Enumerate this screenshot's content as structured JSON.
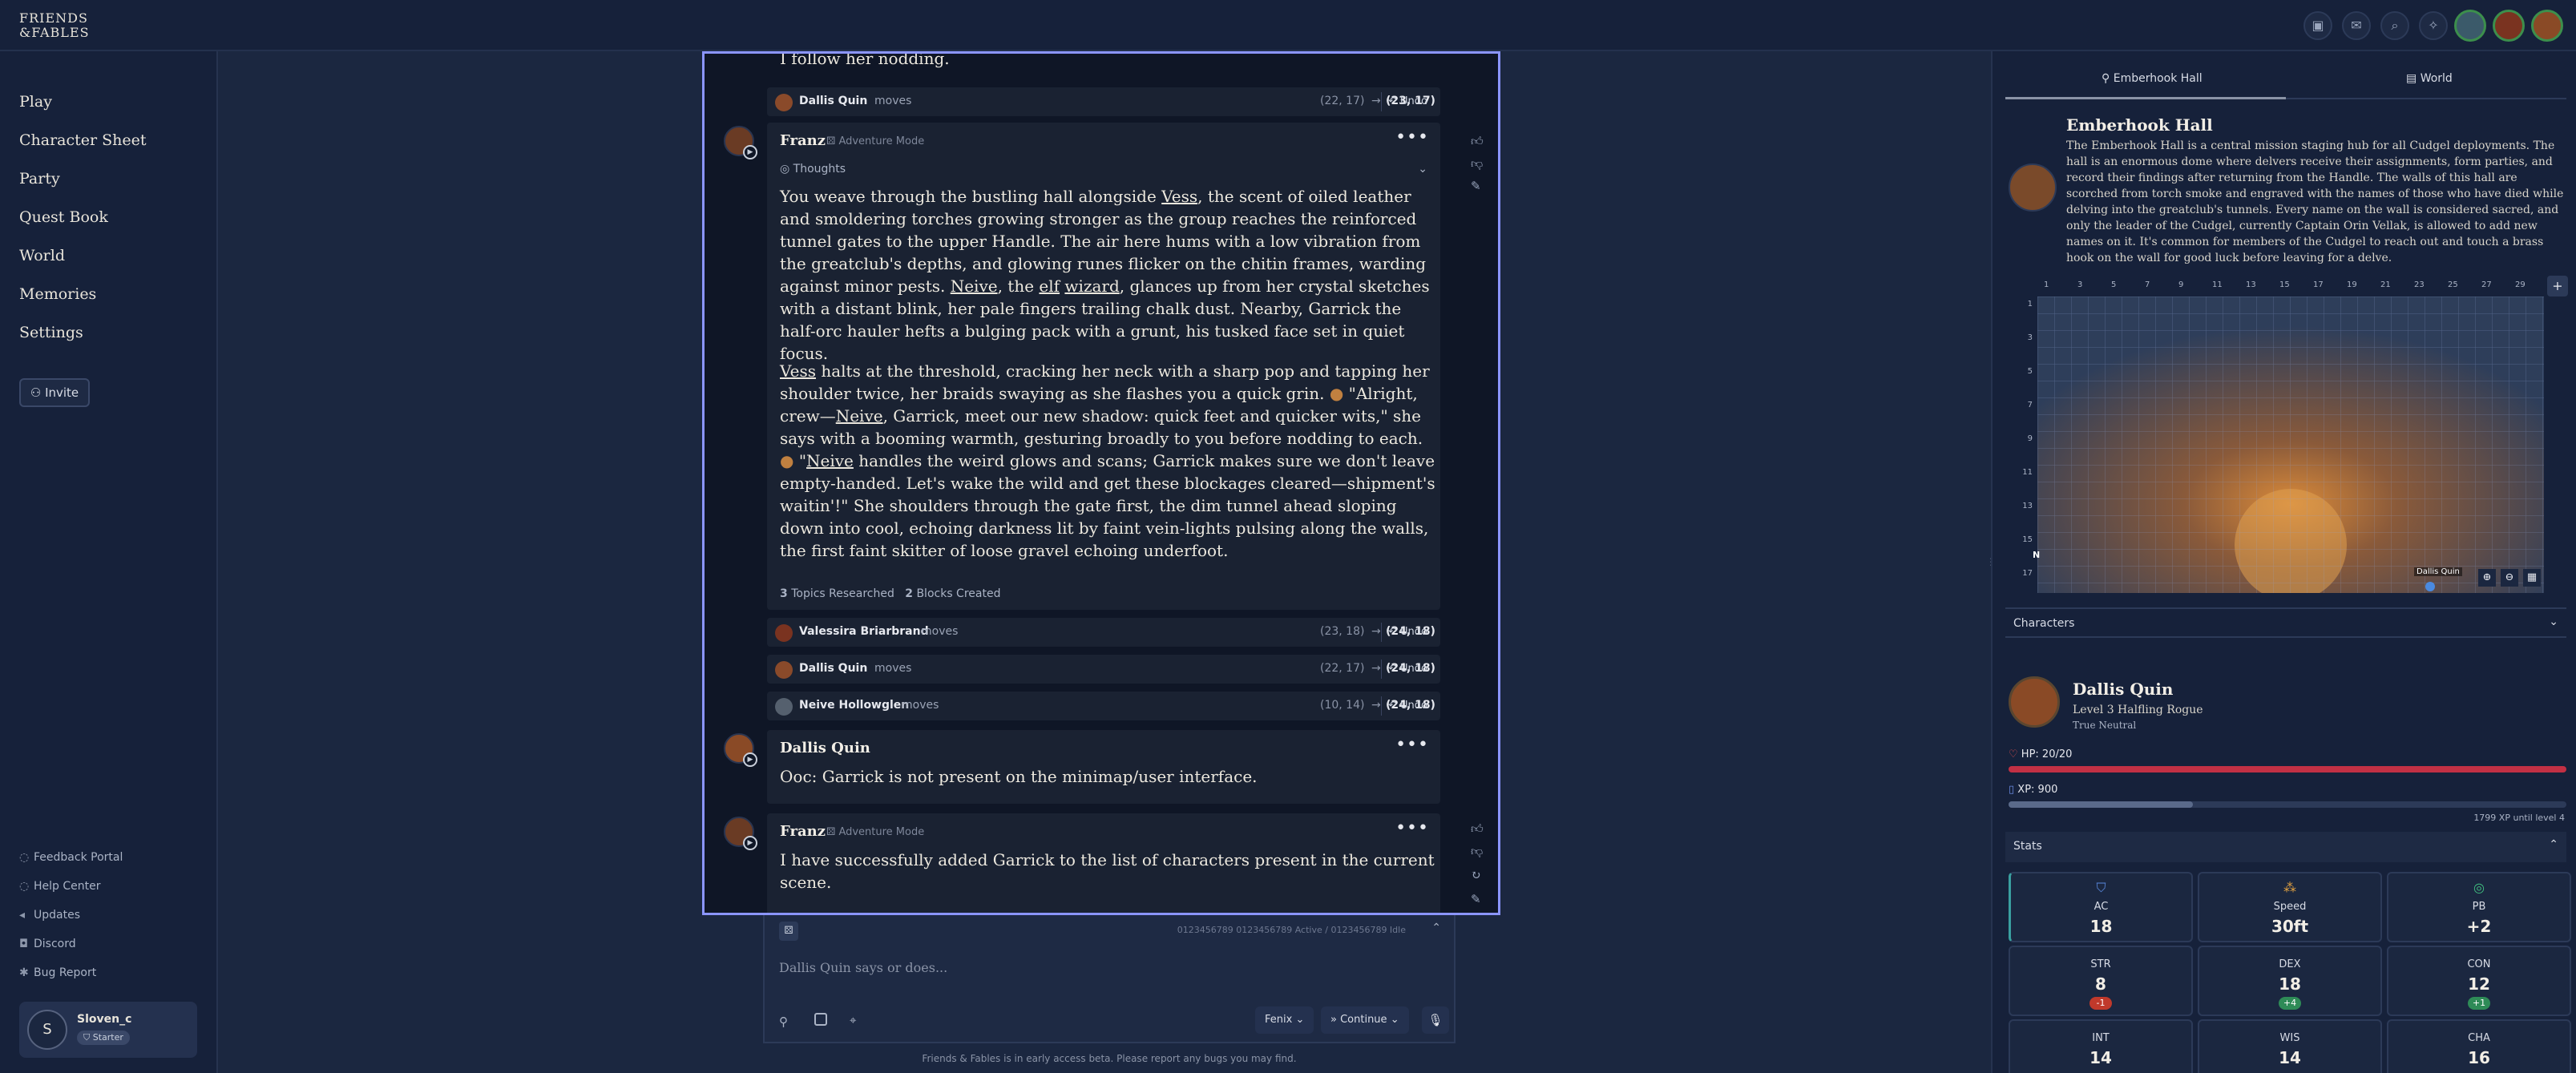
{
  "app": {
    "logo_line1": "FRIENDS",
    "logo_line2": "&FABLES"
  },
  "sidebar": {
    "items": [
      {
        "label": "Play"
      },
      {
        "label": "Character Sheet"
      },
      {
        "label": "Party"
      },
      {
        "label": "Quest Book"
      },
      {
        "label": "World"
      },
      {
        "label": "Memories"
      },
      {
        "label": "Settings"
      }
    ],
    "invite_label": "Invite",
    "footer": [
      {
        "label": "Feedback Portal"
      },
      {
        "label": "Help Center"
      },
      {
        "label": "Updates"
      },
      {
        "label": "Discord"
      },
      {
        "label": "Bug Report"
      }
    ],
    "user": {
      "initial": "S",
      "name": "Sloven_c",
      "tier": "Starter"
    }
  },
  "chat": {
    "cut_text": "I follow her nodding.",
    "moves_top": {
      "name": "Dallis Quin",
      "verb": "moves",
      "from": "(22, 17)",
      "to": "(23, 17)",
      "undo": "Undo"
    },
    "narration": {
      "speaker": "Franz",
      "mode": "Adventure Mode",
      "thoughts": "Thoughts",
      "p1_a": "You weave through the bustling hall alongside ",
      "p1_vess": "Vess",
      "p1_b": ", the scent of oiled leather and smoldering torches growing stronger as the group reaches the reinforced tunnel gates to the upper Handle. The air here hums with a low vibration from the greatclub's depths, and glowing runes flicker on the chitin frames, warding against minor pests. ",
      "p1_neive": "Neive",
      "p1_c": ", the ",
      "p1_elf": "elf",
      "p1_wizard": "wizard",
      "p1_d": ", glances up from her crystal sketches with a distant blink, her pale fingers trailing chalk dust. Nearby, Garrick the half-orc hauler hefts a bulging pack with a grunt, his tusked face set in quiet focus.",
      "p2_vess": "Vess",
      "p2_a": " halts at the threshold, cracking her neck with a sharp pop and tapping her shoulder twice, her braids swaying as she flashes you a quick grin. ",
      "p2_q1": "\"Alright, crew—",
      "p2_neive1": "Neive",
      "p2_b": ", Garrick, meet our new shadow: quick feet and quicker wits,\" she says with a booming warmth, gesturing broadly to you before nodding to each. ",
      "p2_q2": "\"",
      "p2_neive2": "Neive",
      "p2_c": " handles the weird glows and scans; Garrick makes sure we don't leave empty-handed. Let's wake the wild and get these blockages cleared—shipment's waitin'!\" She shoulders through the gate first, the dim tunnel ahead sloping down into cool, echoing darkness lit by faint vein-lights pulsing along the walls, the first faint skitter of loose gravel echoing underfoot.",
      "topics_count": "3",
      "topics_label": "Topics Researched",
      "blocks_count": "2",
      "blocks_label": "Blocks Created"
    },
    "moves": [
      {
        "name": "Valessira Briarbrand",
        "verb": "moves",
        "from": "(23, 18)",
        "to": "(24, 18)",
        "undo": "Undo"
      },
      {
        "name": "Dallis Quin",
        "verb": "moves",
        "from": "(22, 17)",
        "to": "(24, 18)",
        "undo": "Undo"
      },
      {
        "name": "Neive Hollowglen",
        "verb": "moves",
        "from": "(10, 14)",
        "to": "(24, 18)",
        "undo": "Undo"
      }
    ],
    "player_msg": {
      "speaker": "Dallis Quin",
      "text": "Ooc: Garrick is not present on the minimap/user interface."
    },
    "reply": {
      "speaker": "Franz",
      "mode": "Adventure Mode",
      "text": "I have successfully added Garrick to the list of characters present in the current scene."
    }
  },
  "composer": {
    "status": "0123456789 0123456789 Active / 0123456789 Idle",
    "placeholder": "Dallis Quin says or does...",
    "model": "Fenix",
    "continue": "Continue",
    "beta_note": "Friends & Fables is in early access beta. Please report any bugs you may find."
  },
  "right": {
    "tabs": [
      {
        "label": "Emberhook Hall",
        "active": true
      },
      {
        "label": "World",
        "active": false
      }
    ],
    "location_title": "Emberhook Hall",
    "location_desc": "The Emberhook Hall is a central mission staging hub for all Cudgel deployments. The hall is an enormous dome where delvers receive their assignments, form parties, and record their findings after returning from the Handle. The walls of this hall are scorched from torch smoke and engraved with the names of those who have died while delving into the greatclub's tunnels. Every name on the wall is considered sacred, and only the leader of the Cudgel, currently Captain Orin Vellak, is allowed to add new names on it. It's common for members of the Cudgel to reach out and touch a brass hook on the wall for good luck before leaving for a delve.",
    "grid_cols": [
      "1",
      "3",
      "5",
      "7",
      "9",
      "11",
      "13",
      "15",
      "17",
      "19",
      "21",
      "23",
      "25",
      "27",
      "29"
    ],
    "grid_rows": [
      "1",
      "3",
      "5",
      "7",
      "9",
      "11",
      "13",
      "15",
      "17"
    ],
    "compass": "N",
    "map_label": "Dallis Quin",
    "characters_label": "Characters",
    "character": {
      "name": "Dallis Quin",
      "class": "Level 3 Halfling Rogue",
      "alignment": "True Neutral",
      "hp": "HP: 20/20",
      "hp_fraction": 1.0,
      "xp": "XP: 900",
      "xp_fraction": 0.33,
      "xp_next": "1799 XP until level 4"
    },
    "stats_label": "Stats",
    "stats": [
      {
        "label": "AC",
        "value": "18"
      },
      {
        "label": "Speed",
        "value": "30ft"
      },
      {
        "label": "PB",
        "value": "+2"
      },
      {
        "label": "STR",
        "value": "8",
        "mod": "-1",
        "color": "#c0392b"
      },
      {
        "label": "DEX",
        "value": "18",
        "mod": "+4",
        "color": "#2e8b57"
      },
      {
        "label": "CON",
        "value": "12",
        "mod": "+1",
        "color": "#2e8b57"
      },
      {
        "label": "INT",
        "value": "14"
      },
      {
        "label": "WIS",
        "value": "14"
      },
      {
        "label": "CHA",
        "value": "16"
      }
    ]
  }
}
